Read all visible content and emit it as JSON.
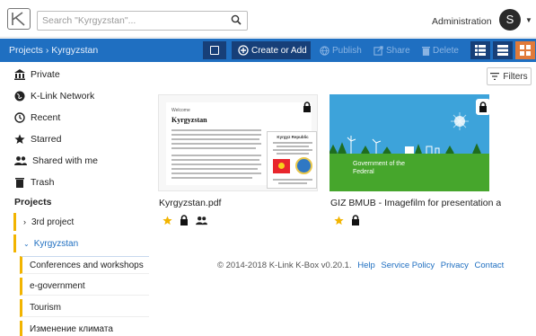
{
  "header": {
    "search_placeholder": "Search \"Kyrgyzstan\"...",
    "user_menu_label": "Administration",
    "avatar_initial": "S"
  },
  "toolbar": {
    "breadcrumb": "Projects › Kyrgyzstan",
    "create_label": "Create or Add",
    "publish_label": "Publish",
    "share_label": "Share",
    "delete_label": "Delete",
    "accent_color": "#1f6fc1",
    "active_view_color": "#e07a3a"
  },
  "sidebar": {
    "items": [
      {
        "label": "Private",
        "icon": "bank-icon"
      },
      {
        "label": "K-Link Network",
        "icon": "globe-icon"
      },
      {
        "label": "Recent",
        "icon": "clock-icon"
      },
      {
        "label": "Starred",
        "icon": "star-icon"
      },
      {
        "label": "Shared with me",
        "icon": "users-icon"
      },
      {
        "label": "Trash",
        "icon": "trash-icon"
      }
    ],
    "projects_title": "Projects",
    "projects": [
      {
        "label": "3rd project",
        "expanded": false
      },
      {
        "label": "Kyrgyzstan",
        "expanded": true
      }
    ],
    "subprojects": [
      "Conferences and workshops",
      "e-government",
      "Tourism",
      "Изменение климата"
    ]
  },
  "main": {
    "filters_label": "Filters",
    "documents": [
      {
        "name": "Kyrgyzstan.pdf",
        "thumb_header": "Welcome",
        "thumb_title": "Kyrgyzstan",
        "thumb_box_title": "Kyrgyz Republic"
      },
      {
        "name": "GIZ BMUB - Imagefilm for presentation a...",
        "thumb_caption_line1": "Government of the",
        "thumb_caption_line2": "Federal"
      }
    ]
  },
  "footer": {
    "copyright": "© 2014-2018 K-Link K-Box v0.20.1.",
    "links": [
      "Help",
      "Service Policy",
      "Privacy",
      "Contact"
    ]
  }
}
